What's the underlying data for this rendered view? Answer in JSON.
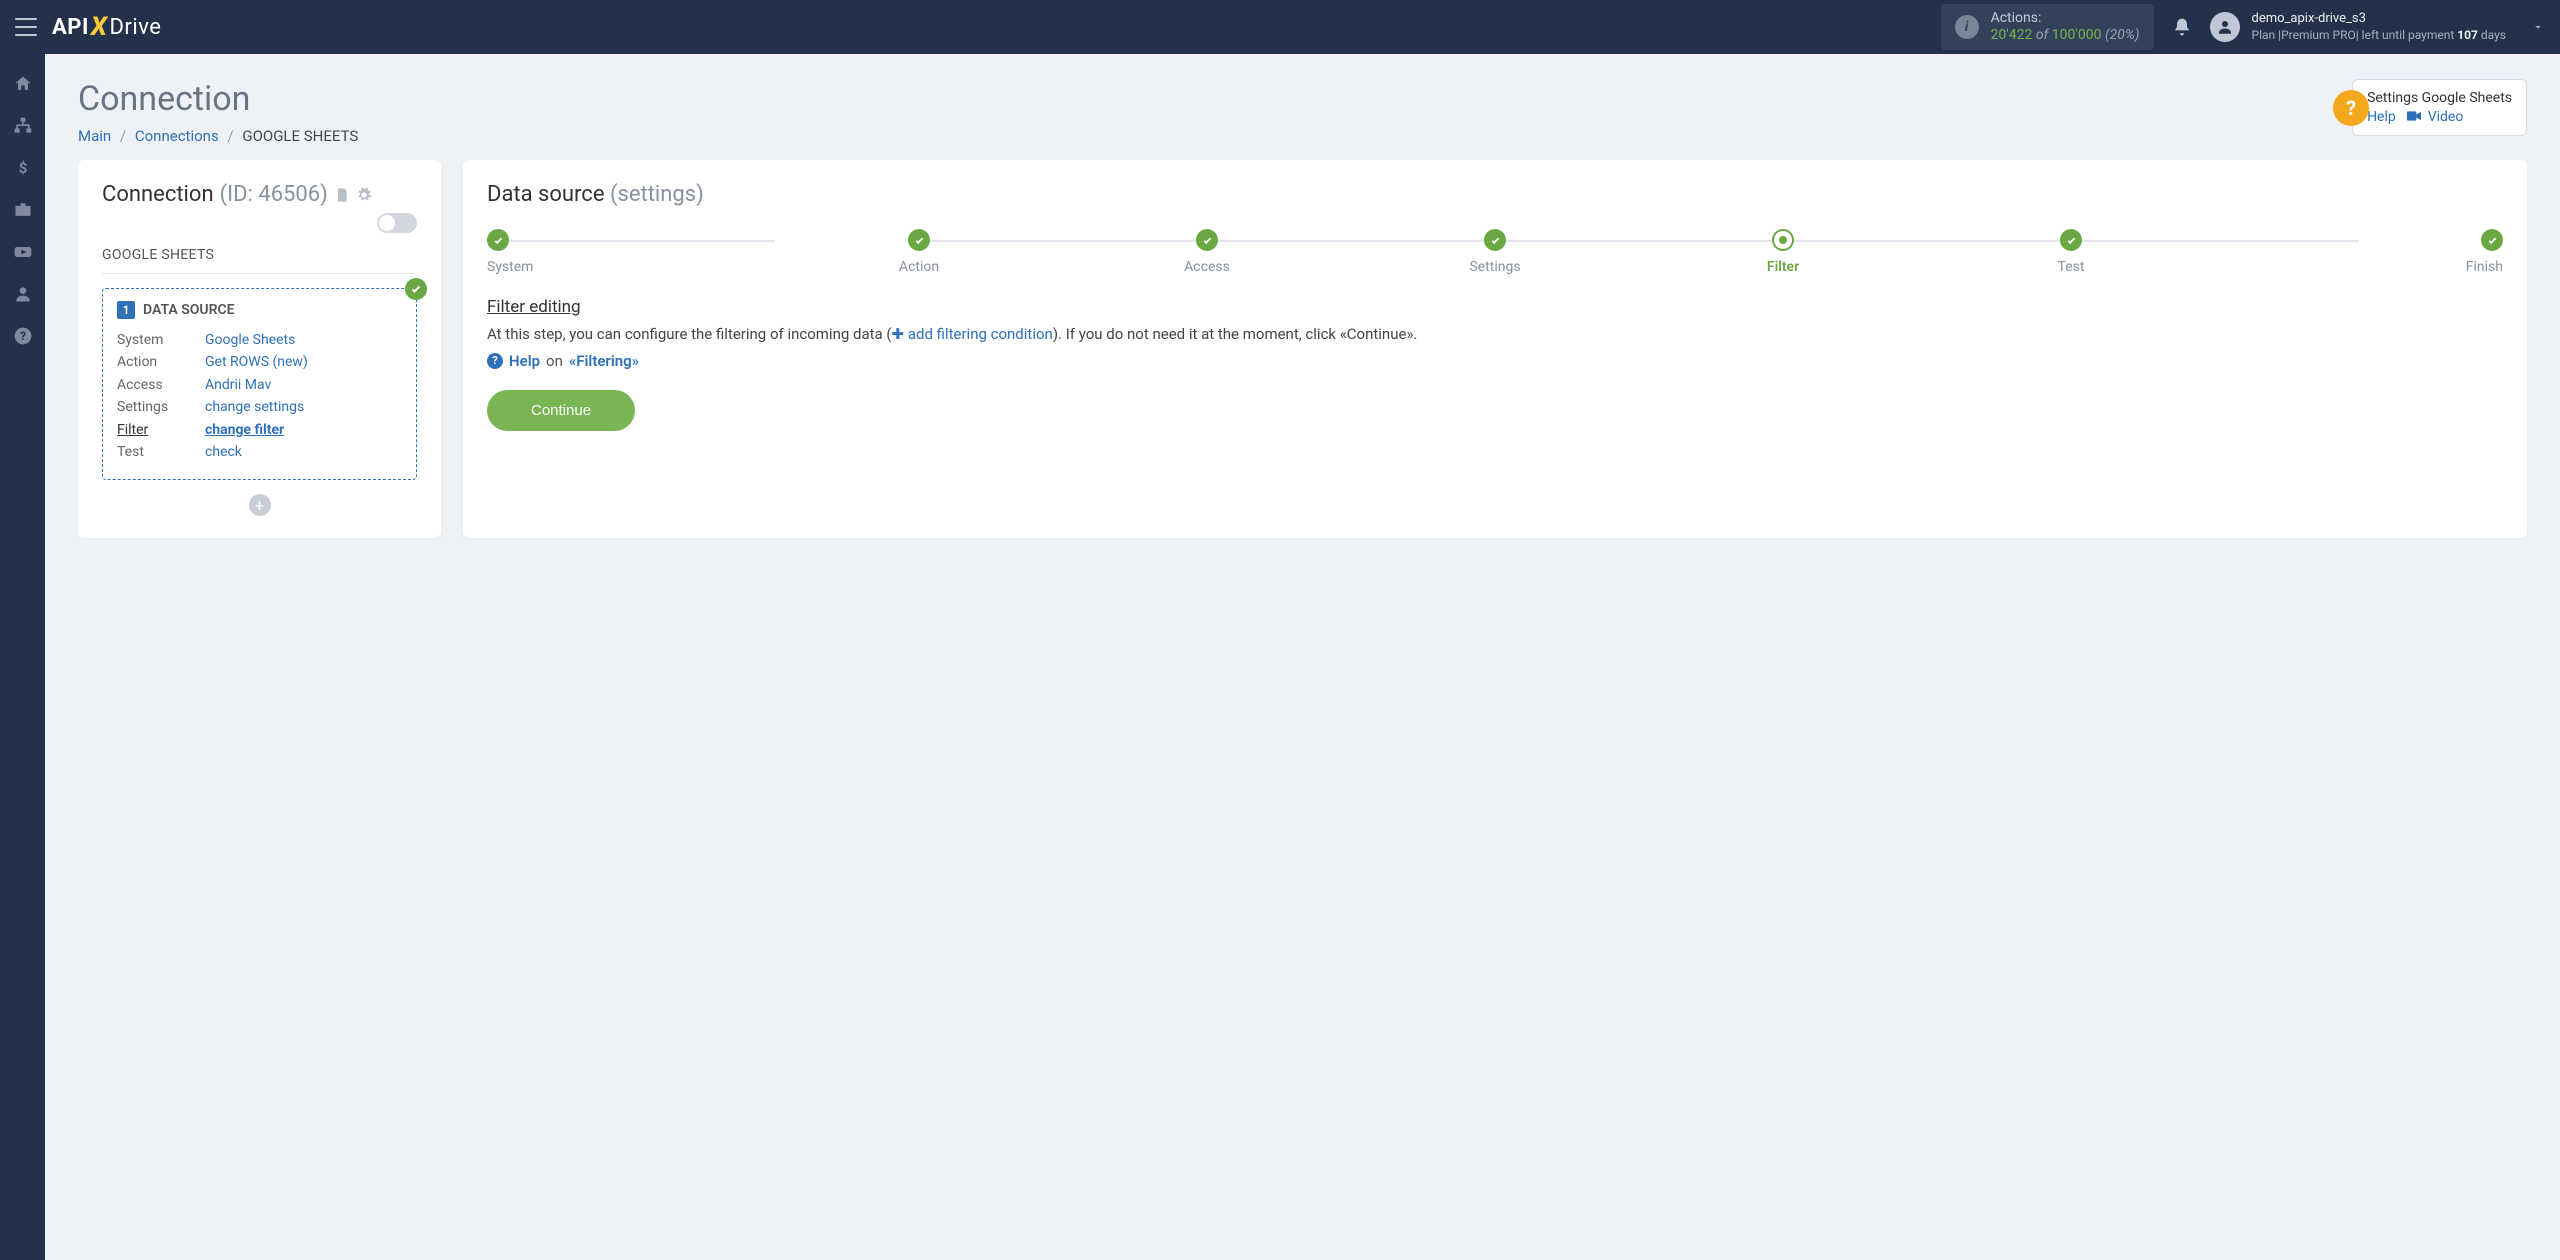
{
  "header": {
    "logo": {
      "api": "API",
      "x": "X",
      "drive": "Drive"
    },
    "actions": {
      "label": "Actions:",
      "used": "20'422",
      "of": "of",
      "total": "100'000",
      "pct": "(20%)"
    },
    "user": {
      "name": "demo_apix-drive_s3",
      "plan_prefix": "Plan |",
      "plan_name": "Premium PRO",
      "plan_mid": "| left until payment ",
      "days": "107",
      "plan_suffix": " days"
    }
  },
  "sidebar": {
    "icons": [
      "home",
      "sitemap",
      "dollar",
      "briefcase",
      "youtube",
      "user",
      "question"
    ]
  },
  "page": {
    "title": "Connection",
    "breadcrumb": {
      "main": "Main",
      "connections": "Connections",
      "current": "GOOGLE SHEETS"
    }
  },
  "help_card": {
    "title": "Settings Google Sheets",
    "help": "Help",
    "video": "Video"
  },
  "left": {
    "conn_label": "Connection",
    "conn_id": "(ID: 46506)",
    "service": "GOOGLE SHEETS",
    "ds_badge": "1",
    "ds_title": "DATA SOURCE",
    "rows": [
      {
        "k": "System",
        "v": "Google Sheets",
        "active": false
      },
      {
        "k": "Action",
        "v": "Get ROWS (new)",
        "active": false
      },
      {
        "k": "Access",
        "v": "Andrii Mav",
        "active": false
      },
      {
        "k": "Settings",
        "v": "change settings",
        "active": false
      },
      {
        "k": "Filter",
        "v": "change filter",
        "active": true
      },
      {
        "k": "Test",
        "v": "check",
        "active": false
      }
    ]
  },
  "right": {
    "title": "Data source",
    "sub": "(settings)",
    "steps": [
      {
        "label": "System",
        "state": "done"
      },
      {
        "label": "Action",
        "state": "done"
      },
      {
        "label": "Access",
        "state": "done"
      },
      {
        "label": "Settings",
        "state": "done"
      },
      {
        "label": "Filter",
        "state": "current"
      },
      {
        "label": "Test",
        "state": "done"
      },
      {
        "label": "Finish",
        "state": "done"
      }
    ],
    "section_title": "Filter editing",
    "body_pre": "At this step, you can configure the filtering of incoming data (",
    "body_link": "add filtering condition",
    "body_post": "). If you do not need it at the moment, click «Continue».",
    "help_link": "Help",
    "help_on": "on",
    "help_topic": "«Filtering»",
    "continue": "Continue"
  }
}
